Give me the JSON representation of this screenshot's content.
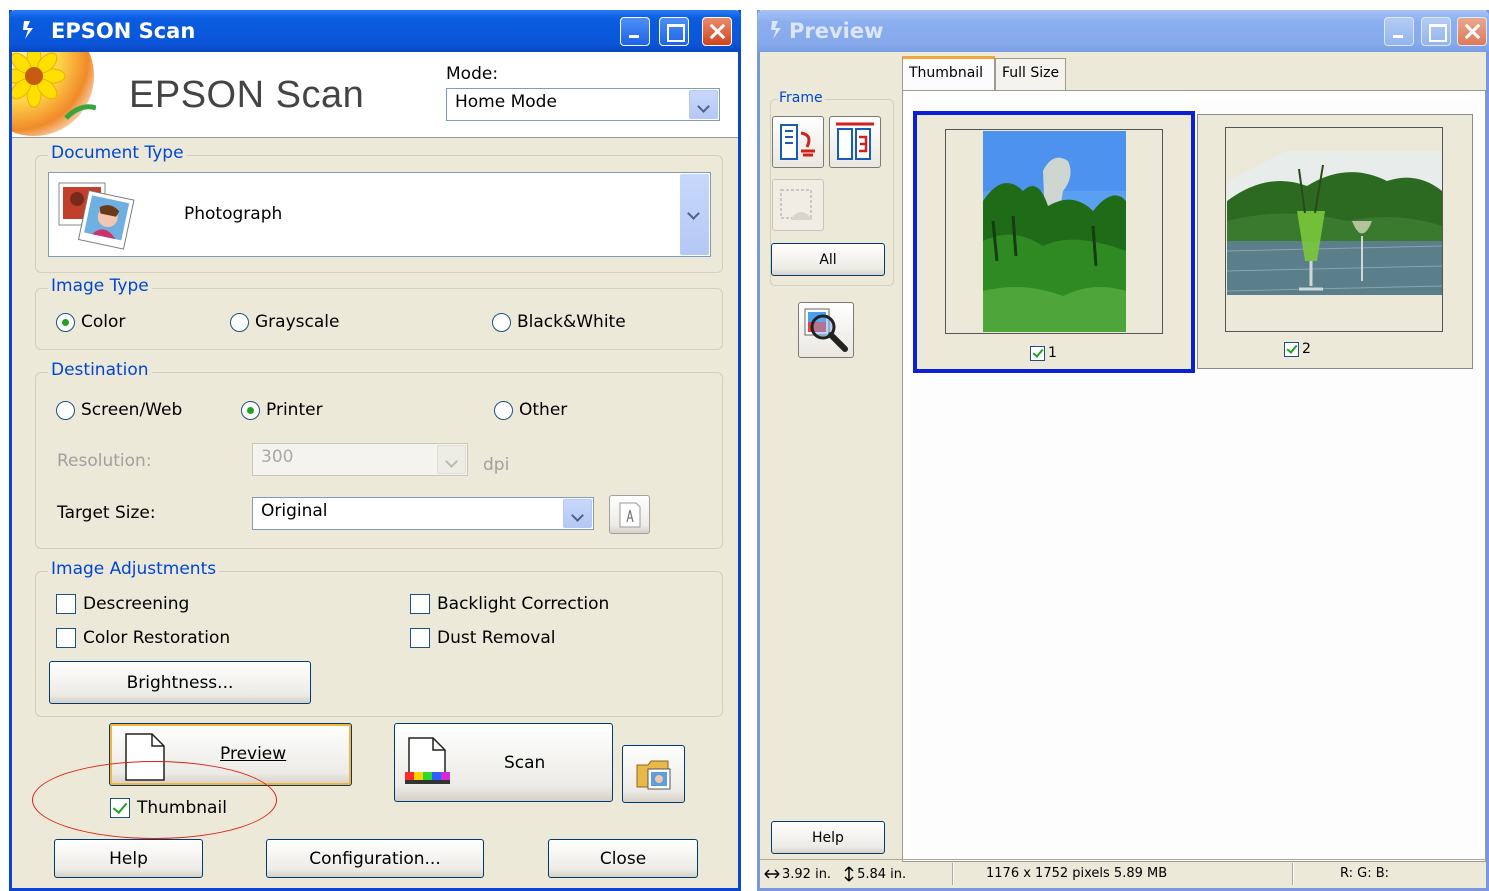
{
  "main_window": {
    "title": "EPSON Scan",
    "app_name": "EPSON Scan",
    "mode_label": "Mode:",
    "mode_value": "Home Mode",
    "document_type": {
      "group_label": "Document Type",
      "value": "Photograph"
    },
    "image_type": {
      "group_label": "Image Type",
      "options": [
        "Color",
        "Grayscale",
        "Black&White"
      ],
      "selected": "Color"
    },
    "destination": {
      "group_label": "Destination",
      "options": [
        "Screen/Web",
        "Printer",
        "Other"
      ],
      "selected": "Printer",
      "resolution_label": "Resolution:",
      "resolution_value": "300",
      "resolution_unit": "dpi",
      "target_size_label": "Target Size:",
      "target_size_value": "Original"
    },
    "image_adjustments": {
      "group_label": "Image Adjustments",
      "descreening": "Descreening",
      "backlight_correction": "Backlight Correction",
      "color_restoration": "Color Restoration",
      "dust_removal": "Dust Removal",
      "brightness_button": "Brightness..."
    },
    "preview_button": "Preview",
    "scan_button": "Scan",
    "thumbnail_label": "Thumbnail",
    "help_button": "Help",
    "configuration_button": "Configuration...",
    "close_button": "Close",
    "accent_color": "#0046d5",
    "annotation_color": "#e0201a"
  },
  "preview_window": {
    "title": "Preview",
    "frame_label": "Frame",
    "all_button": "All",
    "help_button": "Help",
    "tabs": [
      "Thumbnail",
      "Full Size"
    ],
    "thumbnails": [
      {
        "label": "1",
        "checked": true,
        "selected": true
      },
      {
        "label": "2",
        "checked": true,
        "selected": false
      }
    ],
    "status": {
      "width": "3.92 in.",
      "height": "5.84 in.",
      "pixels": "1176 x 1752 pixels 5.89 MB",
      "rgb": "R: G: B:"
    },
    "selection_color": "#0b1fd8"
  }
}
